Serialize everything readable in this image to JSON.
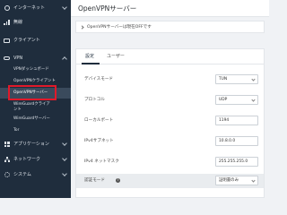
{
  "sidebar": {
    "items": [
      {
        "label": "インターネット",
        "icon": "globe-icon"
      },
      {
        "label": "無線",
        "icon": "wireless-icon"
      },
      {
        "label": "クライアント",
        "icon": "clients-icon"
      },
      {
        "label": "VPN",
        "icon": "vpn-icon"
      }
    ],
    "vpn_submenu": [
      {
        "label": "VPNダッシュボード"
      },
      {
        "label": "OpenVPNクライアント"
      },
      {
        "label": "OpenVPNサーバー",
        "active": true
      },
      {
        "label": "WireGuardクライアント"
      },
      {
        "label": "WireGuardサーバー"
      },
      {
        "label": "Tor"
      }
    ],
    "bottom_items": [
      {
        "label": "アプリケーション",
        "icon": "apps-icon"
      },
      {
        "label": "ネットワーク",
        "icon": "network-icon"
      },
      {
        "label": "システム",
        "icon": "system-icon"
      }
    ]
  },
  "main": {
    "title": "OpenVPNサーバー",
    "status_message": "OpenVPNサーバーは現在OFFです",
    "tabs": [
      {
        "label": "設定",
        "active": true
      },
      {
        "label": "ユーザー",
        "active": false
      }
    ],
    "form": {
      "rows": [
        {
          "label": "デバイスモード",
          "value": "TUN",
          "type": "select"
        },
        {
          "label": "プロトコル",
          "value": "UDP",
          "type": "select"
        },
        {
          "label": "ローカルポート",
          "value": "1194",
          "type": "input"
        },
        {
          "label": "IPv4サブネット",
          "value": "10.8.0.0",
          "type": "input"
        },
        {
          "label": "IPv4 ネットマスク",
          "value": "255.255.255.0",
          "type": "input"
        },
        {
          "label": "認証モード",
          "value": "証明書のみ",
          "type": "select",
          "help": "?"
        }
      ]
    }
  },
  "colors": {
    "sidebar_bg": "#1f2d3d",
    "highlight": "#e0192a",
    "page_bg": "#f0f2f5"
  }
}
